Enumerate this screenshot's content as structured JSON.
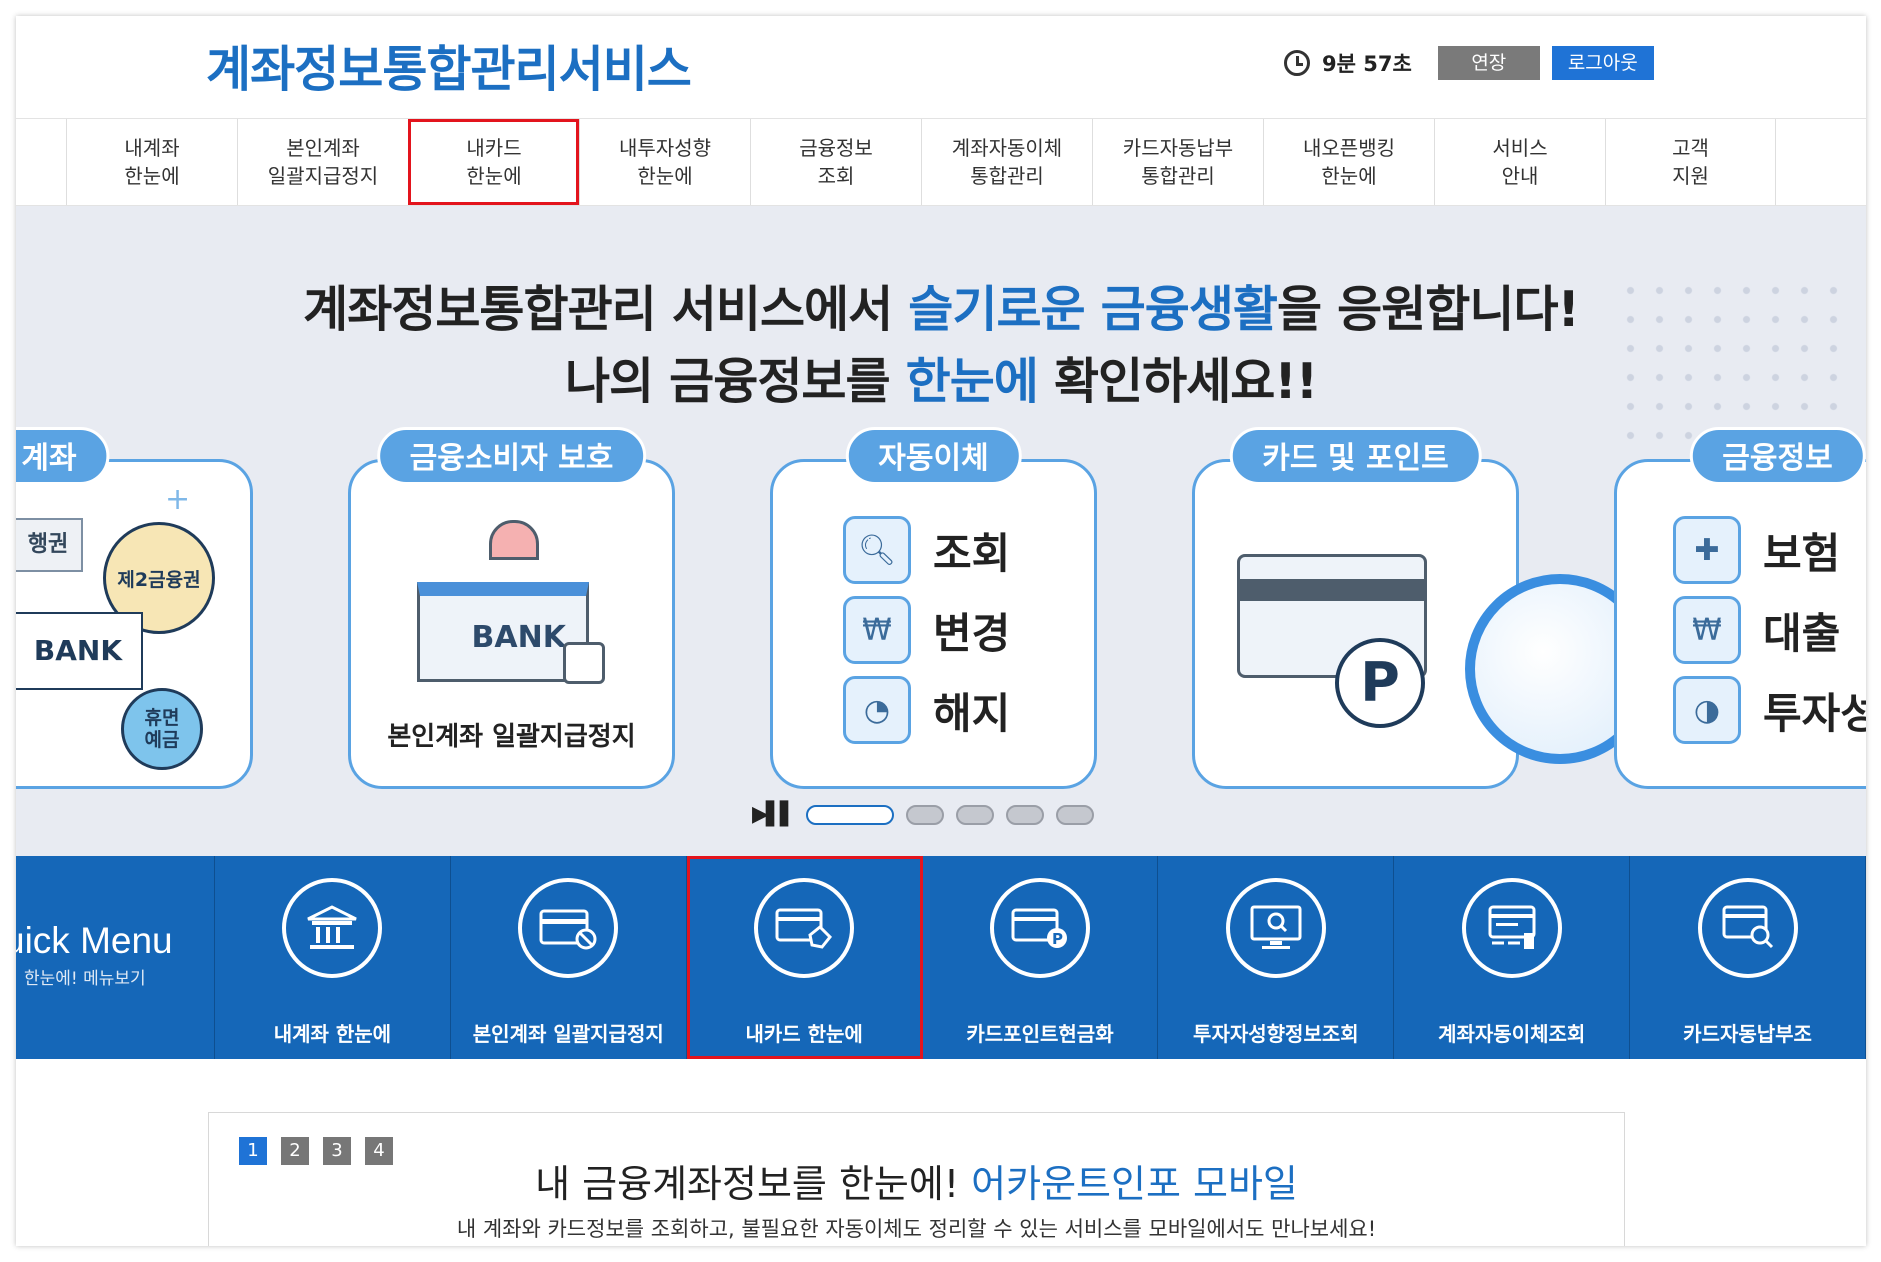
{
  "header": {
    "logo": "계좌정보통합관리서비스",
    "timer_icon": "clock-icon",
    "timer": "9분 57초",
    "extend_label": "연장",
    "logout_label": "로그아웃"
  },
  "nav": [
    {
      "line1": "내계좌",
      "line2": "한눈에"
    },
    {
      "line1": "본인계좌",
      "line2": "일괄지급정지"
    },
    {
      "line1": "내카드",
      "line2": "한눈에"
    },
    {
      "line1": "내투자성향",
      "line2": "한눈에"
    },
    {
      "line1": "금융정보",
      "line2": "조회"
    },
    {
      "line1": "계좌자동이체",
      "line2": "통합관리"
    },
    {
      "line1": "카드자동납부",
      "line2": "통합관리"
    },
    {
      "line1": "내오픈뱅킹",
      "line2": "한눈에"
    },
    {
      "line1": "서비스",
      "line2": "안내"
    },
    {
      "line1": "고객",
      "line2": "지원"
    }
  ],
  "hero": {
    "line1_a": "계좌정보통합관리 서비스에서 ",
    "line1_b": "슬기로운 금융생활",
    "line1_c": "을 응원합니다!",
    "line2_a": "나의 금융정보를 ",
    "line2_b": "한눈에",
    "line2_c": " 확인하세요!!",
    "cards": {
      "account": {
        "title": "계좌",
        "bank_label": "행권",
        "second": "제2금융권",
        "bank": "BANK",
        "dormant1": "휴면",
        "dormant2": "예금"
      },
      "consumer": {
        "title": "금융소비자 보호",
        "bank": "BANK",
        "caption": "본인계좌 일괄지급정지"
      },
      "auto": {
        "title": "자동이체",
        "items": [
          "조회",
          "변경",
          "해지"
        ]
      },
      "points": {
        "title": "카드 및 포인트",
        "p": "P"
      },
      "info": {
        "title": "금융정보",
        "items": [
          "보험",
          "대출",
          "투자성"
        ]
      }
    },
    "slider": {
      "active_index": 0,
      "count": 5
    }
  },
  "quick": {
    "title": "uick Menu",
    "subtitle": "한눈에! 메뉴보기",
    "items": [
      {
        "label": "내계좌 한눈에",
        "icon": "bank-building-icon"
      },
      {
        "label": "본인계좌 일괄지급정지",
        "icon": "card-block-icon"
      },
      {
        "label": "내카드 한눈에",
        "icon": "card-hand-icon"
      },
      {
        "label": "카드포인트현금화",
        "icon": "card-point-icon"
      },
      {
        "label": "투자자성향정보조회",
        "icon": "monitor-search-icon"
      },
      {
        "label": "계좌자동이체조회",
        "icon": "transfer-list-icon"
      },
      {
        "label": "카드자동납부조",
        "icon": "card-search-icon"
      }
    ]
  },
  "promo": {
    "tabs": [
      "1",
      "2",
      "3",
      "4"
    ],
    "active_tab": "1",
    "title_a": "내 금융계좌정보를 한눈에! ",
    "title_b": "어카운트인포 모바일",
    "desc": "내 계좌와 카드정보를 조회하고, 불필요한 자동이체도 정리할 수 있는 서비스를 모바일에서도 만나보세요!"
  }
}
